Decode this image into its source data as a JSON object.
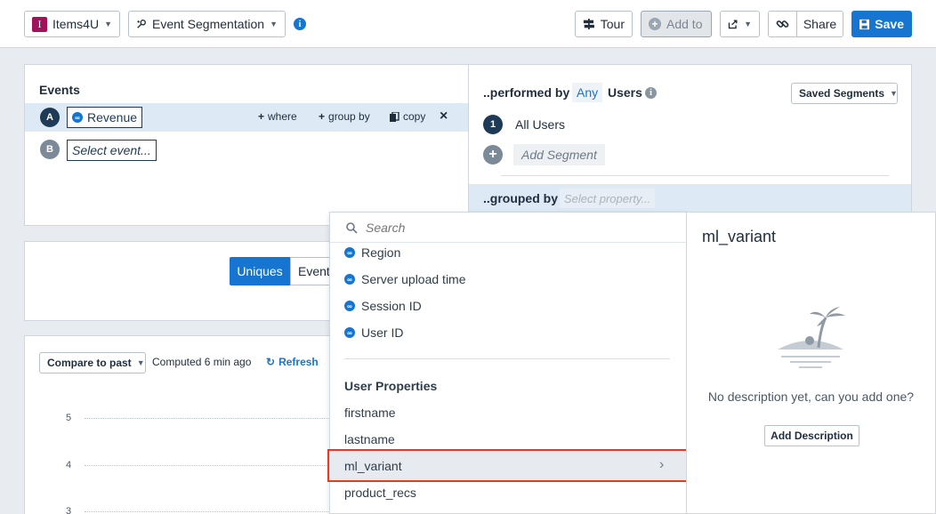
{
  "topbar": {
    "project": "Items4U",
    "project_badge": "I",
    "chart_type": "Event Segmentation",
    "tour": "Tour",
    "add_to": "Add to",
    "share": "Share",
    "save": "Save"
  },
  "events": {
    "title": "Events",
    "rows": [
      {
        "badge": "A",
        "event": "Revenue"
      },
      {
        "badge": "B",
        "placeholder": "Select event..."
      }
    ],
    "actions": {
      "where": "where",
      "group_by": "group by",
      "copy": "copy"
    }
  },
  "segments": {
    "performed_by": "..performed by",
    "any": "Any",
    "users": "Users",
    "saved_segments": "Saved Segments",
    "items": [
      {
        "num": "1",
        "label": "All Users"
      }
    ],
    "add_segment": "Add Segment",
    "grouped_by": "..grouped by",
    "select_property": "Select property..."
  },
  "metric_toggle": {
    "uniques": "Uniques",
    "event": "Event"
  },
  "chart_toolbar": {
    "compare": "Compare to past",
    "computed": "Computed 6 min ago",
    "refresh": "Refresh"
  },
  "chart": {
    "y_ticks": [
      "5",
      "4",
      "3"
    ]
  },
  "dropdown": {
    "search_placeholder": "Search",
    "event_properties": [
      "Region",
      "Server upload time",
      "Session ID",
      "User ID"
    ],
    "user_properties_title": "User Properties",
    "user_properties": [
      "firstname",
      "lastname",
      "ml_variant",
      "product_recs"
    ],
    "selected": "ml_variant"
  },
  "detail": {
    "title": "ml_variant",
    "description": "No description yet, can you add one?",
    "add_description": "Add Description"
  },
  "colors": {
    "accent": "#1675d1",
    "highlight": "#e23c22",
    "selected_row": "#dde9f5",
    "badge_dark": "#1d3a56",
    "badge_grey": "#7c8a97"
  }
}
